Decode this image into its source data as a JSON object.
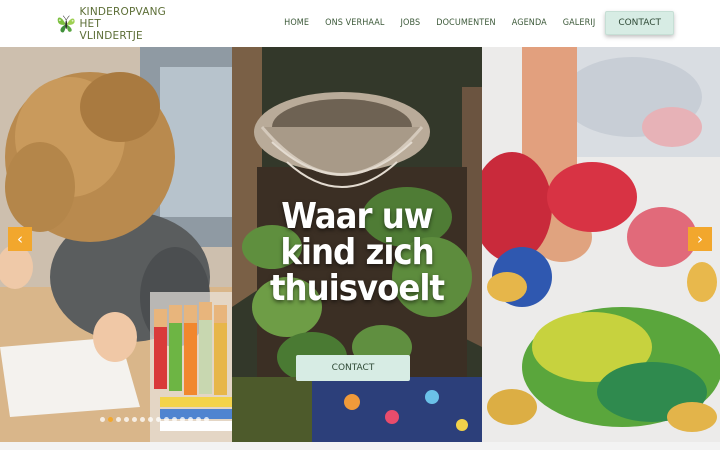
{
  "brand": {
    "line1": "KINDEROPVANG",
    "line2": "HET VLINDERTJE",
    "logo_icon": "butterfly-icon"
  },
  "nav": {
    "items": [
      {
        "label": "HOME"
      },
      {
        "label": "ONS VERHAAL"
      },
      {
        "label": "JOBS"
      },
      {
        "label": "DOCUMENTEN"
      },
      {
        "label": "AGENDA"
      },
      {
        "label": "GALERIJ"
      }
    ],
    "contact": "CONTACT"
  },
  "hero": {
    "title_lines": [
      "Waar uw",
      "kind zich",
      "thuisvoelt"
    ],
    "cta": "CONTACT",
    "prev_icon": "chevron-left-icon",
    "next_icon": "chevron-right-icon",
    "prev_glyph": "‹",
    "next_glyph": "›",
    "slide_count": 14,
    "active_slide": 2
  },
  "colors": {
    "accent": "#f2a72d",
    "button_bg": "#d7ece4",
    "nav_text": "#3d5a3a",
    "brand_green": "#5c6e36"
  }
}
